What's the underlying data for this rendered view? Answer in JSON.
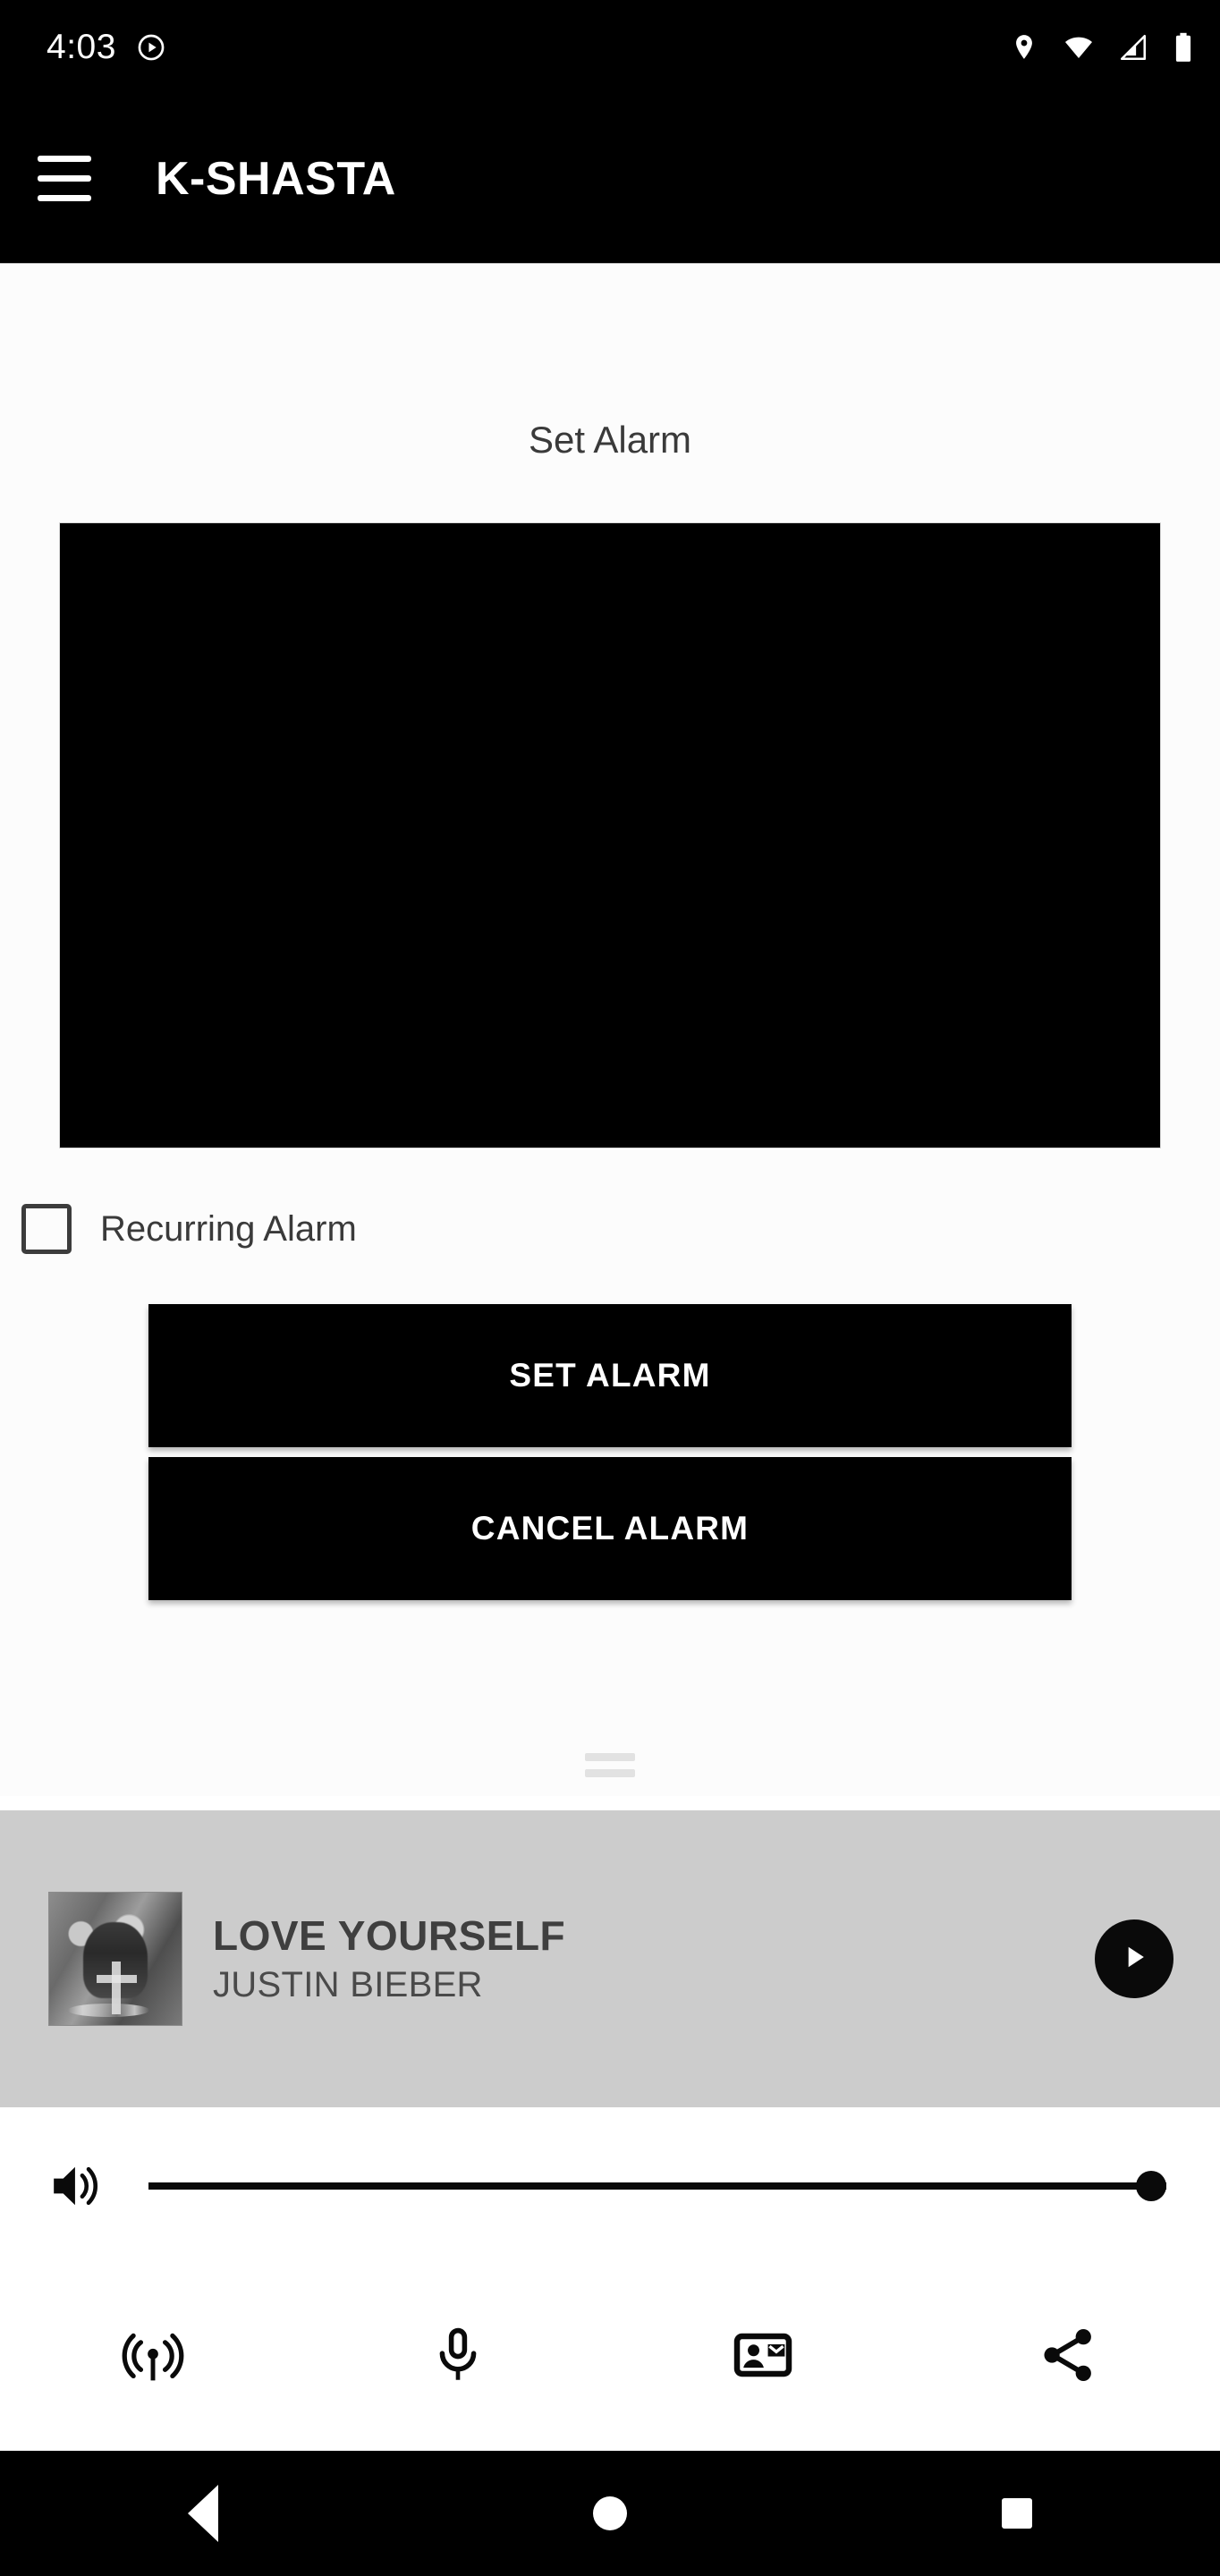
{
  "status_bar": {
    "clock": "4:03",
    "icons": [
      "play-circle-icon",
      "location-pin-icon",
      "wifi-icon",
      "cellular-signal-icon",
      "battery-icon"
    ]
  },
  "app_bar": {
    "menu_icon": "hamburger-menu-icon",
    "title": "K-SHASTA"
  },
  "main": {
    "section_title": "Set Alarm",
    "time_picker": {
      "name": "time-picker",
      "value": "",
      "background": "#000000"
    },
    "recurring": {
      "label": "Recurring Alarm",
      "checked": false
    },
    "buttons": [
      {
        "label": "SET ALARM",
        "name": "set-alarm-button"
      },
      {
        "label": "CANCEL ALARM",
        "name": "cancel-alarm-button"
      }
    ]
  },
  "media_player": {
    "drag_handle": "drag-handle",
    "album_art_alt": "album-artwork",
    "title": "LOVE YOURSELF",
    "artist": "JUSTIN BIEBER",
    "play_button": "play-icon",
    "panel_color": "#cccccc"
  },
  "volume": {
    "icon": "volume-up-icon",
    "value": 100,
    "min": 0,
    "max": 100
  },
  "actions": [
    {
      "name": "broadcast-icon",
      "label": "Broadcast"
    },
    {
      "name": "microphone-icon",
      "label": "Microphone"
    },
    {
      "name": "contact-card-icon",
      "label": "Contact"
    },
    {
      "name": "share-icon",
      "label": "Share"
    }
  ],
  "nav_bar": {
    "back": "back-icon",
    "home": "home-icon",
    "recents": "recents-icon"
  },
  "colors": {
    "accent": "#000000",
    "panel": "#cccccc",
    "text": "#3a3a3a",
    "surface": "#ffffff"
  }
}
